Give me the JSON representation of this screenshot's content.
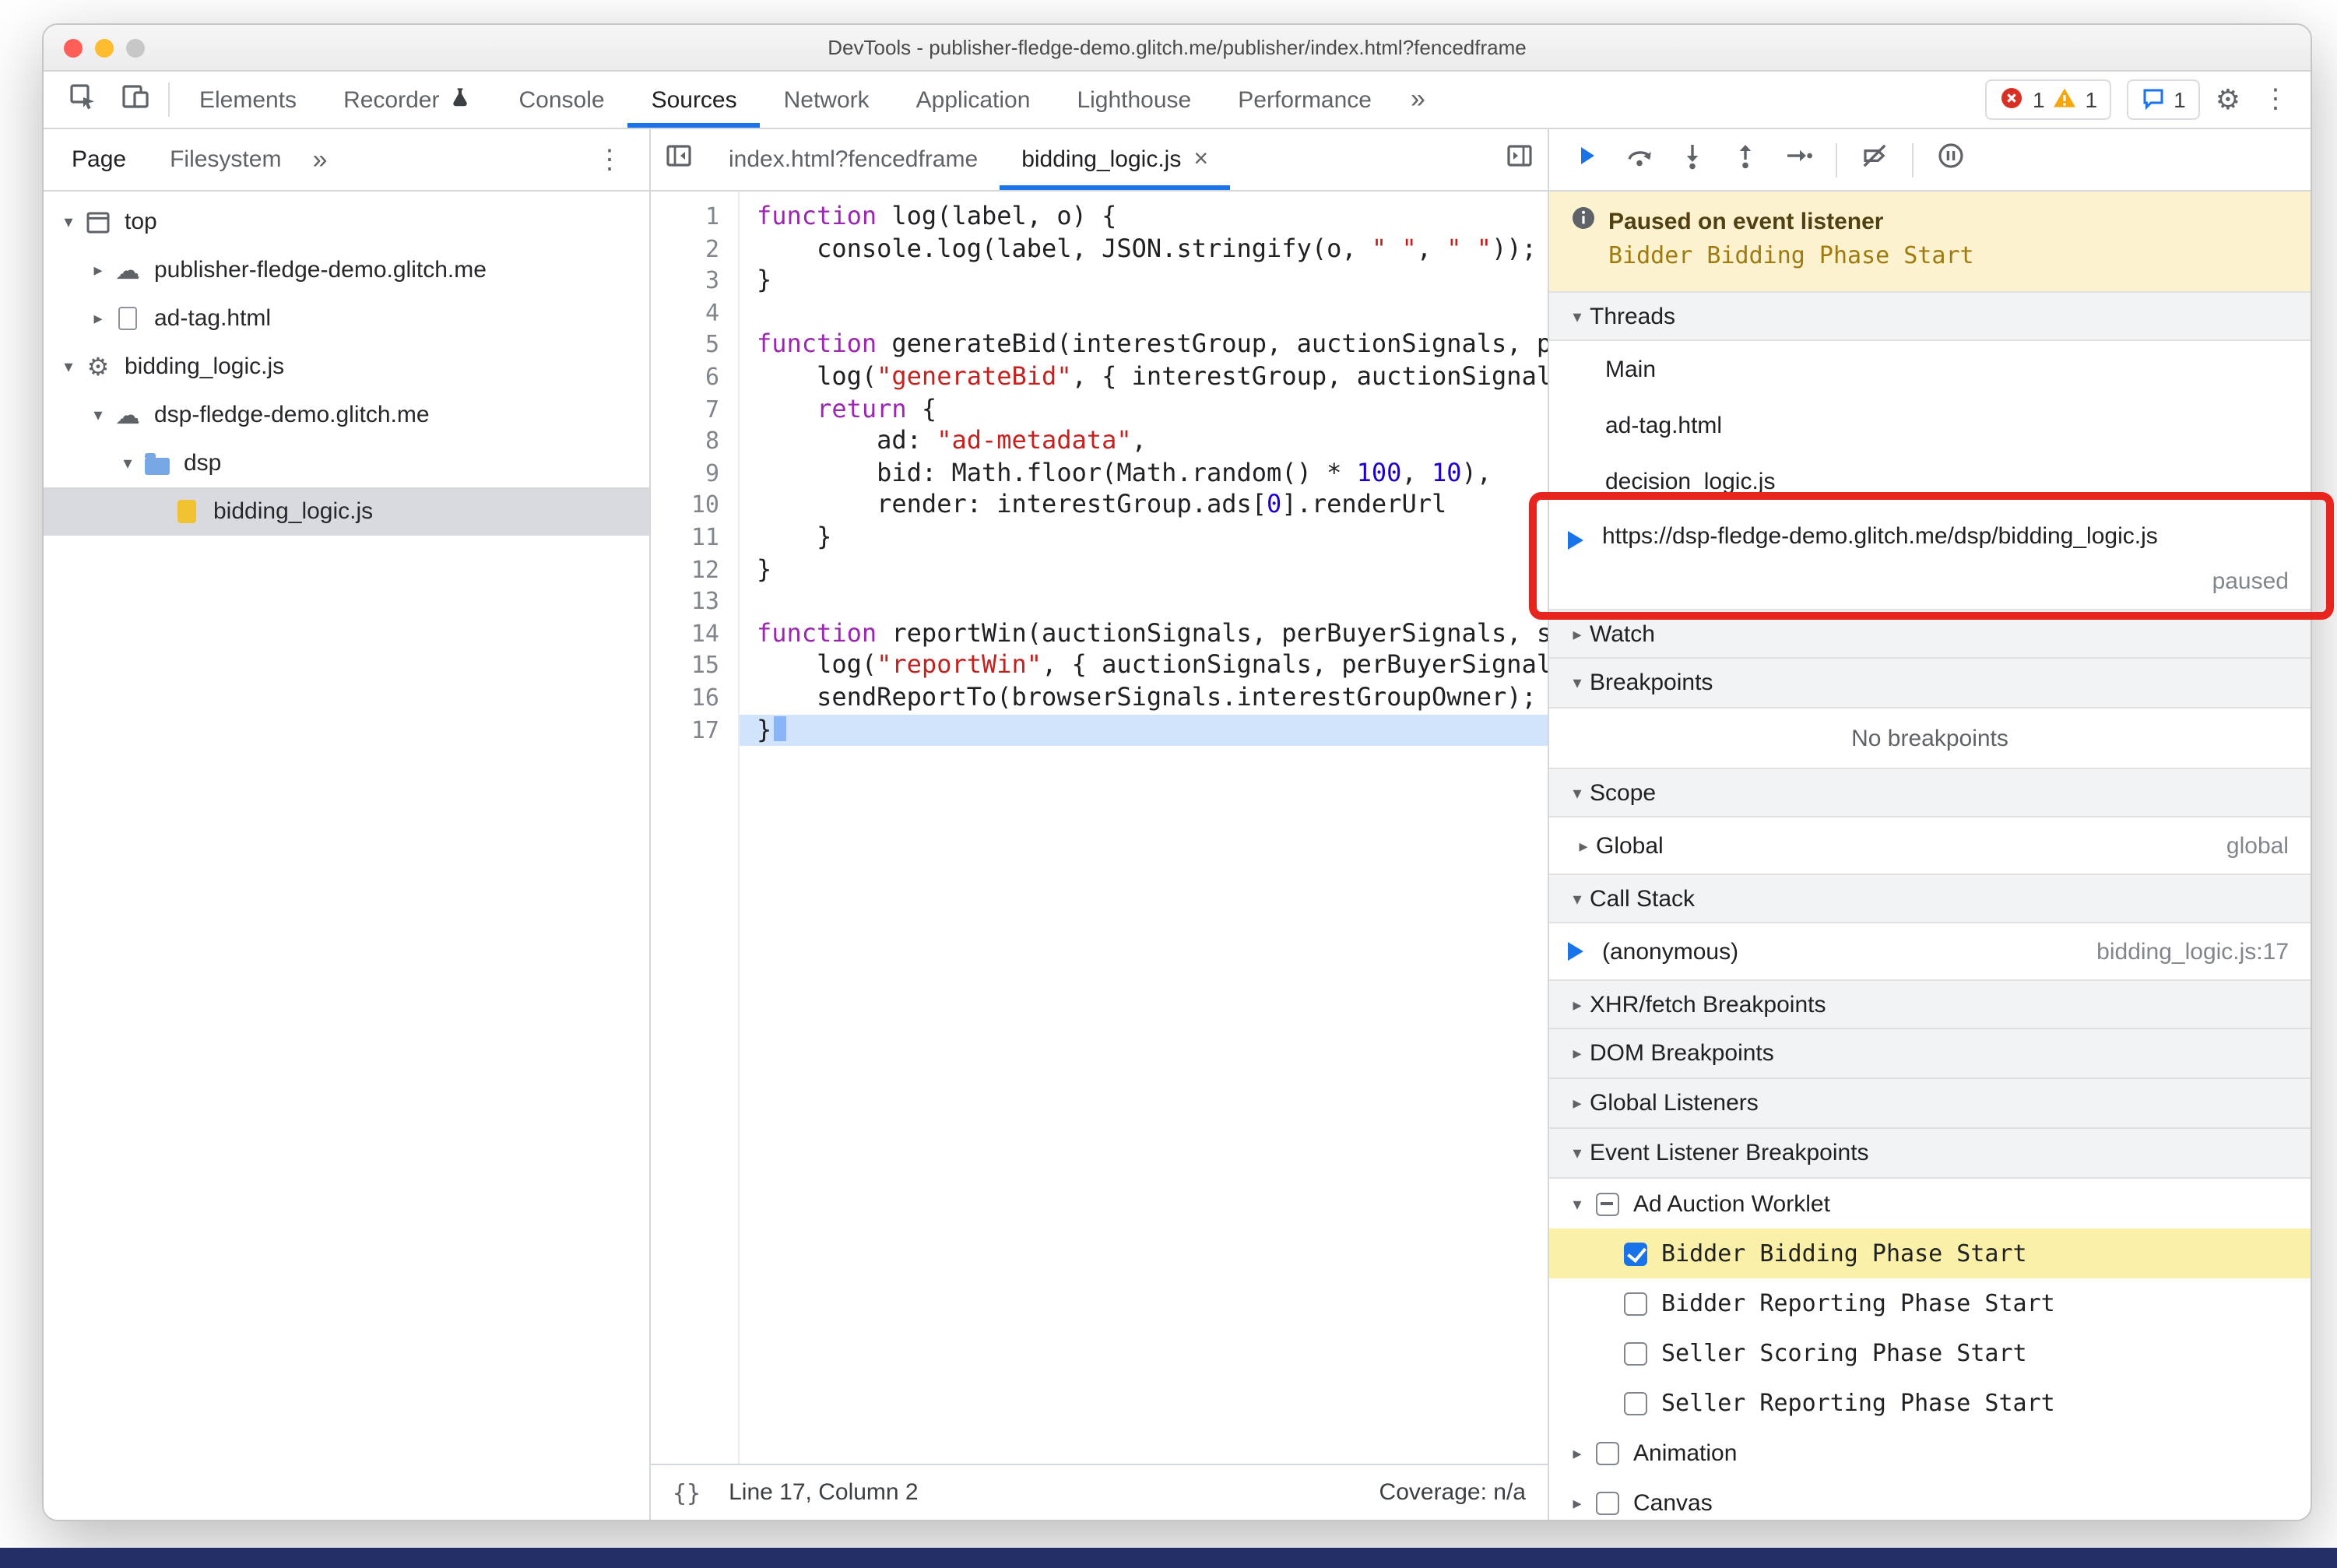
{
  "colors": {
    "accent_blue": "#1a73e8",
    "error_red": "#d93025",
    "warning_yellow": "#f5a70a",
    "annotation_red": "#e8251c",
    "event_highlight_yellow": "#fbf0a7",
    "paused_banner_bg": "#fcf2cf"
  },
  "window": {
    "title": "DevTools - publisher-fledge-demo.glitch.me/publisher/index.html?fencedframe"
  },
  "toolbar": {
    "tabs": [
      {
        "label": "Elements"
      },
      {
        "label": "Recorder",
        "icon": "flask"
      },
      {
        "label": "Console"
      },
      {
        "label": "Sources",
        "active": true
      },
      {
        "label": "Network"
      },
      {
        "label": "Application"
      },
      {
        "label": "Lighthouse"
      },
      {
        "label": "Performance"
      }
    ],
    "overflow": "»",
    "error_count": "1",
    "warning_count": "1",
    "issues_count": "1"
  },
  "navigator": {
    "tabs": [
      {
        "label": "Page",
        "active": true
      },
      {
        "label": "Filesystem"
      }
    ],
    "overflow": "»",
    "menu": "⋮",
    "tree": [
      {
        "label": "top",
        "level": 0,
        "arrow": "expanded",
        "icon": "frame"
      },
      {
        "label": "publisher-fledge-demo.glitch.me",
        "level": 1,
        "arrow": "collapsed",
        "icon": "cloud"
      },
      {
        "label": "ad-tag.html",
        "level": 1,
        "arrow": "collapsed",
        "icon": "doc"
      },
      {
        "label": "bidding_logic.js",
        "level": 0,
        "arrow": "expanded",
        "icon": "gear"
      },
      {
        "label": "dsp-fledge-demo.glitch.me",
        "level": 1,
        "arrow": "expanded",
        "icon": "cloud"
      },
      {
        "label": "dsp",
        "level": 2,
        "arrow": "expanded",
        "icon": "folder"
      },
      {
        "label": "bidding_logic.js",
        "level": 3,
        "arrow": "none",
        "icon": "file",
        "selected": true
      }
    ]
  },
  "editor": {
    "tabs": [
      {
        "label": "index.html?fencedframe"
      },
      {
        "label": "bidding_logic.js",
        "active": true,
        "close": "×"
      }
    ],
    "status": {
      "pretty_print": "{}",
      "cursor": "Line 17, Column 2",
      "coverage": "Coverage: n/a"
    },
    "code_lines": [
      {
        "n": "1",
        "segs": [
          [
            "kw",
            "function"
          ],
          [
            "pl",
            " log(label, o) {"
          ]
        ]
      },
      {
        "n": "2",
        "segs": [
          [
            "pl",
            "    console.log(label, JSON.stringify(o, "
          ],
          [
            "str",
            "\" \""
          ],
          [
            "pl",
            ", "
          ],
          [
            "str",
            "\" \""
          ],
          [
            "pl",
            "));"
          ]
        ]
      },
      {
        "n": "3",
        "segs": [
          [
            "pl",
            "}"
          ]
        ]
      },
      {
        "n": "4",
        "segs": []
      },
      {
        "n": "5",
        "segs": [
          [
            "kw",
            "function"
          ],
          [
            "pl",
            " generateBid(interestGroup, auctionSignals, perBuyerSignals, trustedBiddingSignals, browserSignals) {"
          ]
        ]
      },
      {
        "n": "6",
        "segs": [
          [
            "pl",
            "    log("
          ],
          [
            "str",
            "\"generateBid\""
          ],
          [
            "pl",
            ", { interestGroup, auctionSignals, perBuyerSignals, trustedBiddingSignals, browserSignals });"
          ]
        ]
      },
      {
        "n": "7",
        "segs": [
          [
            "pl",
            "    "
          ],
          [
            "kw",
            "return"
          ],
          [
            "pl",
            " {"
          ]
        ]
      },
      {
        "n": "8",
        "segs": [
          [
            "pl",
            "        ad: "
          ],
          [
            "str",
            "\"ad-metadata\""
          ],
          [
            "pl",
            ","
          ]
        ]
      },
      {
        "n": "9",
        "segs": [
          [
            "pl",
            "        bid: Math.floor(Math.random() * "
          ],
          [
            "num",
            "100"
          ],
          [
            "pl",
            ", "
          ],
          [
            "num",
            "10"
          ],
          [
            "pl",
            "),"
          ]
        ]
      },
      {
        "n": "10",
        "segs": [
          [
            "pl",
            "        render: interestGroup.ads["
          ],
          [
            "num",
            "0"
          ],
          [
            "pl",
            "].renderUrl"
          ]
        ]
      },
      {
        "n": "11",
        "segs": [
          [
            "pl",
            "    }"
          ]
        ]
      },
      {
        "n": "12",
        "segs": [
          [
            "pl",
            "}"
          ]
        ]
      },
      {
        "n": "13",
        "segs": []
      },
      {
        "n": "14",
        "segs": [
          [
            "kw",
            "function"
          ],
          [
            "pl",
            " reportWin(auctionSignals, perBuyerSignals, sellerSignals, browserSignals) {"
          ]
        ]
      },
      {
        "n": "15",
        "segs": [
          [
            "pl",
            "    log("
          ],
          [
            "str",
            "\"reportWin\""
          ],
          [
            "pl",
            ", { auctionSignals, perBuyerSignals, sellerSignals, browserSignals });"
          ]
        ]
      },
      {
        "n": "16",
        "segs": [
          [
            "pl",
            "    sendReportTo(browserSignals.interestGroupOwner);"
          ]
        ]
      },
      {
        "n": "17",
        "segs": [
          [
            "pl",
            "}"
          ]
        ],
        "current": true
      }
    ]
  },
  "debugger": {
    "toolbar": [
      {
        "name": "resume"
      },
      {
        "name": "step-over"
      },
      {
        "name": "step-into"
      },
      {
        "name": "step-out"
      },
      {
        "name": "step"
      },
      {
        "name": "separator"
      },
      {
        "name": "deactivate-breakpoints"
      },
      {
        "name": "separator"
      },
      {
        "name": "pause-exceptions"
      }
    ],
    "paused": {
      "title": "Paused on event listener",
      "detail": "Bidder Bidding Phase Start"
    },
    "sections": [
      {
        "type": "header",
        "label": "Threads",
        "expanded": true
      },
      {
        "type": "row",
        "label": "Main"
      },
      {
        "type": "row",
        "label": "ad-tag.html"
      },
      {
        "type": "row",
        "label": "decision_logic.js"
      },
      {
        "type": "thread",
        "label": "https://dsp-fledge-demo.glitch.me/dsp/bidding_logic.js",
        "status": "paused",
        "active": true,
        "annotated": true
      },
      {
        "type": "header",
        "label": "Watch",
        "expanded": false
      },
      {
        "type": "header",
        "label": "Breakpoints",
        "expanded": true
      },
      {
        "type": "empty",
        "label": "No breakpoints"
      },
      {
        "type": "header",
        "label": "Scope",
        "expanded": true
      },
      {
        "type": "scope",
        "label": "Global",
        "right": "global"
      },
      {
        "type": "header",
        "label": "Call Stack",
        "expanded": true
      },
      {
        "type": "frame",
        "label": "(anonymous)",
        "right": "bidding_logic.js:17",
        "active": true
      },
      {
        "type": "header",
        "label": "XHR/fetch Breakpoints",
        "expanded": false
      },
      {
        "type": "header",
        "label": "DOM Breakpoints",
        "expanded": false
      },
      {
        "type": "header",
        "label": "Global Listeners",
        "expanded": false
      },
      {
        "type": "header",
        "label": "Event Listener Breakpoints",
        "expanded": true
      },
      {
        "type": "category",
        "label": "Ad Auction Worklet",
        "checkbox": "indeterminate",
        "expanded": true
      },
      {
        "type": "event",
        "label": "Bidder Bidding Phase Start",
        "checked": true,
        "highlight": true
      },
      {
        "type": "event",
        "label": "Bidder Reporting Phase Start",
        "checked": false
      },
      {
        "type": "event",
        "label": "Seller Scoring Phase Start",
        "checked": false
      },
      {
        "type": "event",
        "label": "Seller Reporting Phase Start",
        "checked": false
      },
      {
        "type": "category",
        "label": "Animation",
        "checkbox": "unchecked",
        "expanded": false
      },
      {
        "type": "category",
        "label": "Canvas",
        "checkbox": "unchecked",
        "expanded": false
      }
    ]
  }
}
